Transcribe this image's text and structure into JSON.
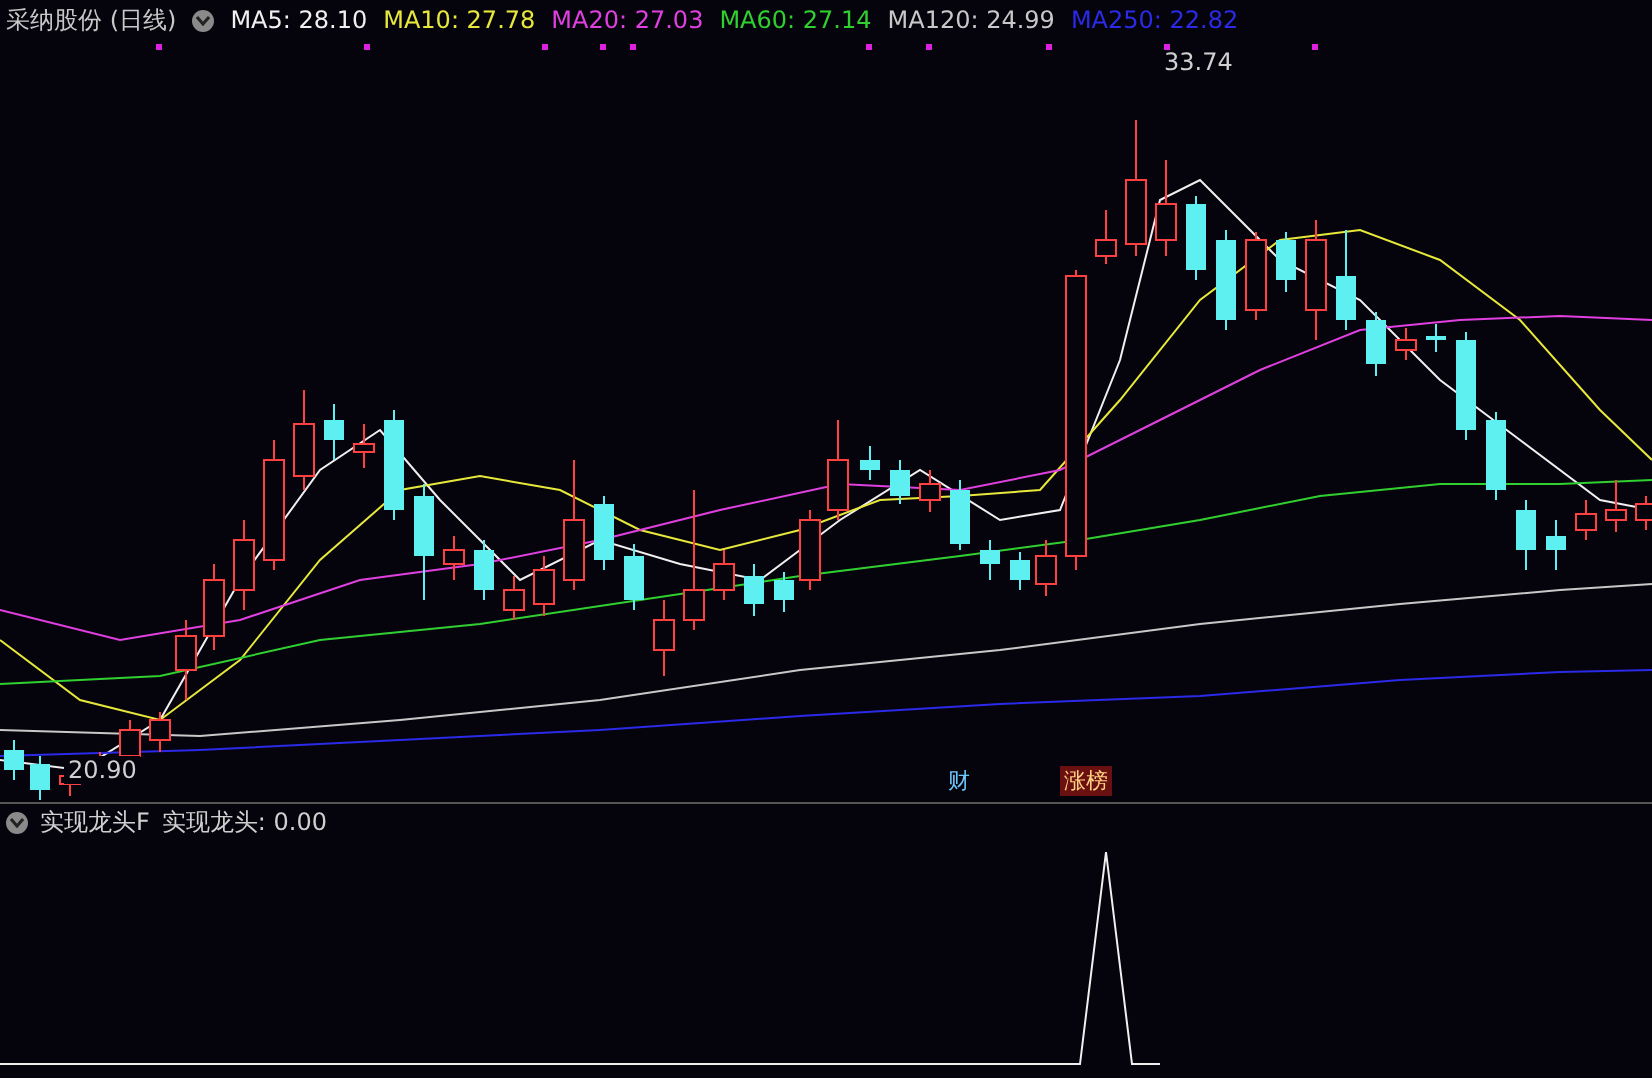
{
  "title": "采纳股份 (日线)",
  "indicators": [
    {
      "label": "MA5: 28.10",
      "color": "#f0f0f0"
    },
    {
      "label": "MA10: 27.78",
      "color": "#e8e83c"
    },
    {
      "label": "MA20: 27.03",
      "color": "#e040e0"
    },
    {
      "label": "MA60: 27.14",
      "color": "#30d030"
    },
    {
      "label": "MA120: 24.99",
      "color": "#c8c8c8"
    },
    {
      "label": "MA250: 22.82",
      "color": "#2a2ae8"
    }
  ],
  "high_label": "33.74",
  "low_label": "20.90",
  "event_tags": [
    {
      "text": "财",
      "kind": "finance"
    },
    {
      "text": "涨榜",
      "kind": "limit"
    }
  ],
  "lower_panel": {
    "title": "实现龙头F",
    "reading": "实现龙头: 0.00"
  }
}
